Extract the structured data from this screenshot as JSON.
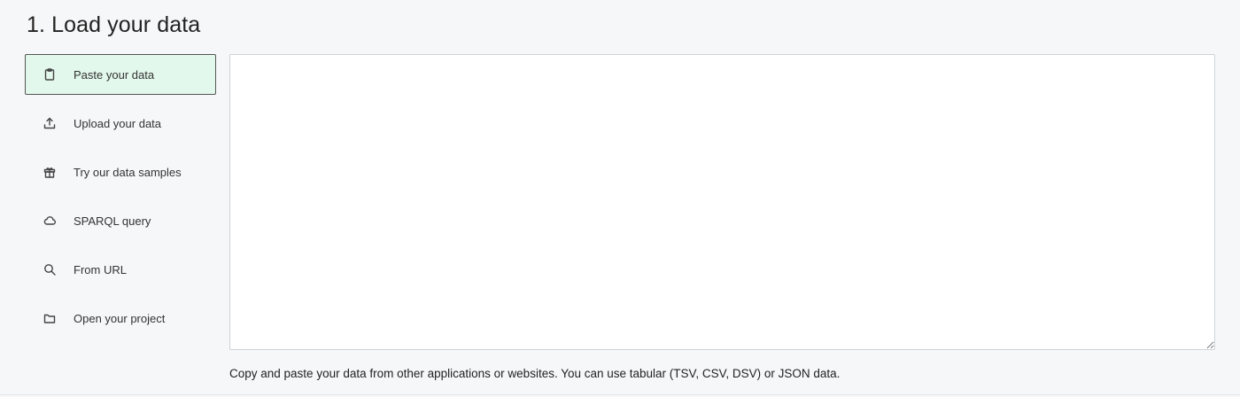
{
  "section": {
    "title": "1. Load your data"
  },
  "sources": [
    {
      "label": "Paste your data",
      "icon": "clipboard-icon",
      "active": true
    },
    {
      "label": "Upload your data",
      "icon": "upload-icon",
      "active": false
    },
    {
      "label": "Try our data samples",
      "icon": "gift-icon",
      "active": false
    },
    {
      "label": "SPARQL query",
      "icon": "cloud-icon",
      "active": false
    },
    {
      "label": "From URL",
      "icon": "search-icon",
      "active": false
    },
    {
      "label": "Open your project",
      "icon": "folder-icon",
      "active": false
    }
  ],
  "textarea": {
    "value": "",
    "placeholder": ""
  },
  "help": {
    "text": "Copy and paste your data from other applications or websites. You can use tabular (TSV, CSV, DSV) or JSON data."
  },
  "colors": {
    "background": "#f6f7f8",
    "active_item_bg": "#e3f8ec",
    "active_item_border": "#555555"
  }
}
